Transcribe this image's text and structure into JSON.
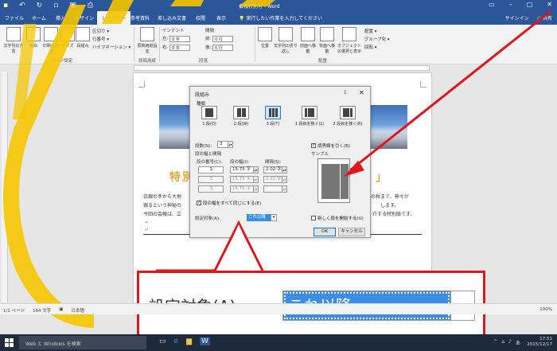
{
  "window": {
    "title": "会報特別号 - Word",
    "user": "サインイン",
    "share": "共有"
  },
  "tabs": [
    "ファイル",
    "ホーム",
    "挿入",
    "デザイン",
    "レイアウト",
    "参考資料",
    "差し込み文書",
    "校閲",
    "表示"
  ],
  "active_tab": "レイアウト",
  "tell_me": "実行したい作業を入力してください",
  "ribbon": {
    "page_setup": [
      "文字列の方向",
      "余白",
      "印刷の向き",
      "サイズ",
      "段組み"
    ],
    "breaks": "区切り",
    "line_numbers": "行番号",
    "hyphenation": "ハイフネーション",
    "page_setup_label": "ページ設定",
    "manuscript": "原稿用紙設定",
    "manuscript_label": "原稿用紙",
    "indent": "インデント",
    "spacing": "間隔",
    "indent_left": "左:",
    "indent_right": "右:",
    "indent_left_val": "0 字",
    "indent_right_val": "0 字",
    "space_before": "前:",
    "space_after": "後:",
    "space_before_val": "0 行",
    "space_after_val": "0 行",
    "paragraph_label": "段落",
    "arrange": [
      "位置",
      "文字列の折り返し",
      "前面へ移動",
      "背面へ移動",
      "オブジェクトの選択と表示"
    ],
    "align": "配置",
    "group": "グループ化",
    "rotate": "回転",
    "arrange_label": "配置"
  },
  "document": {
    "heading": "特別",
    "heading_end": "！」",
    "lines": [
      "白銀の冬から大地",
      "宿るという神秘の",
      "今回の会報は、立"
    ],
    "lines_right": [
      "紅の秋まで、神々が",
      "します。",
      "介する特別版です。"
    ]
  },
  "dialog": {
    "title": "段組み",
    "help": "?",
    "close": "✕",
    "presets_label": "種類",
    "presets": [
      "1 段(O)",
      "2 段(W)",
      "3 段(T)",
      "1 段目を狭く(L)",
      "2 段目を狭く(R)"
    ],
    "selected_preset": "3 段(T)",
    "count_label": "段数(N):",
    "count_value": "3",
    "line_between": "境界線を引く(B)",
    "width_spacing_label": "段の幅と間隔",
    "col_headers": [
      "段の番号(C):",
      "段の幅(I):",
      "間隔(S):"
    ],
    "rows": [
      {
        "num": "1:",
        "width": "15.75 字",
        "spacing": "2.02 字"
      },
      {
        "num": "2:",
        "width": "15.75 字",
        "spacing": "2.02 字"
      },
      {
        "num": "3:",
        "width": "15.75 字",
        "spacing": ""
      }
    ],
    "equal_width": "段の幅をすべて同じにする(E)",
    "sample_label": "サンプル",
    "apply_label": "設定対象(A):",
    "apply_value": "これ以降",
    "new_column": "新しく段を開始する(U)",
    "ok": "OK",
    "cancel": "キャンセル"
  },
  "callout": {
    "label": "設定対象(A):",
    "value": "これ以降"
  },
  "status": {
    "page": "1/1 ページ",
    "words": "164 文字",
    "language": "日本語",
    "zoom": "100%"
  },
  "taskbar": {
    "search": "Web と Windows を検索",
    "time": "17:51",
    "date": "2015/12/17"
  },
  "colors": {
    "accent": "#2b579a",
    "highlight": "#e0161a",
    "selection": "#3a8ee6",
    "heading": "#e8a33a",
    "watermark": "#f5c500"
  }
}
